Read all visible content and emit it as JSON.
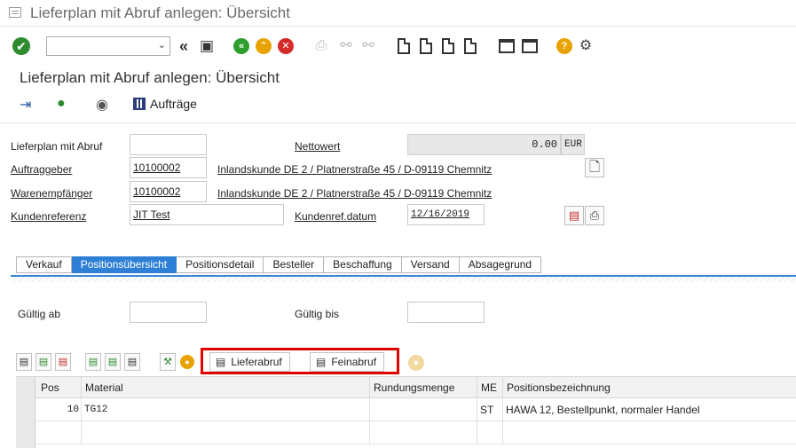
{
  "window": {
    "title": "Lieferplan mit Abruf anlegen: Übersicht"
  },
  "screen": {
    "title": "Lieferplan mit Abruf anlegen: Übersicht"
  },
  "toolbar": {
    "command_value": ""
  },
  "app_toolbar": {
    "orders_label": "Aufträge"
  },
  "header": {
    "lieferplan_label": "Lieferplan mit Abruf",
    "lieferplan_value": "",
    "auftraggeber_label": "Auftraggeber",
    "auftraggeber_value": "10100002",
    "auftraggeber_desc": "Inlandskunde DE 2 / Platnerstraße 45 / D-09119 Chemnitz",
    "warenempfaenger_label": "Warenempfänger",
    "warenempfaenger_value": "10100002",
    "warenempfaenger_desc": "Inlandskunde DE 2 / Platnerstraße 45 / D-09119 Chemnitz",
    "kundenreferenz_label": "Kundenreferenz",
    "kundenreferenz_value": "JIT Test",
    "nettowert_label": "Nettowert",
    "nettowert_value": "0.00",
    "currency": "EUR",
    "kundenref_datum_label": "Kundenref.datum",
    "kundenref_datum_value": "12/16/2019"
  },
  "tabs": [
    "Verkauf",
    "Positionsübersicht",
    "Positionsdetail",
    "Besteller",
    "Beschaffung",
    "Versand",
    "Absagegrund"
  ],
  "active_tab": "Positionsübersicht",
  "validity": {
    "gueltig_ab_label": "Gültig ab",
    "gueltig_ab_value": "",
    "gueltig_bis_label": "Gültig bis",
    "gueltig_bis_value": ""
  },
  "table_toolbar": {
    "lieferabruf_label": "Lieferabruf",
    "feinabruf_label": "Feinabruf"
  },
  "table": {
    "columns": [
      "Pos",
      "Material",
      "Rundungsmenge",
      "ME",
      "Positionsbezeichnung"
    ],
    "rows": [
      {
        "pos": "10",
        "material": "TG12",
        "rundungsmenge": "",
        "me": "ST",
        "bezeichnung": "HAWA 12, Bestellpunkt, normaler Handel"
      }
    ]
  },
  "colors": {
    "active_tab": "#2e7fd6",
    "highlight_border": "#e00000",
    "ok_green": "#2e8b2e"
  }
}
